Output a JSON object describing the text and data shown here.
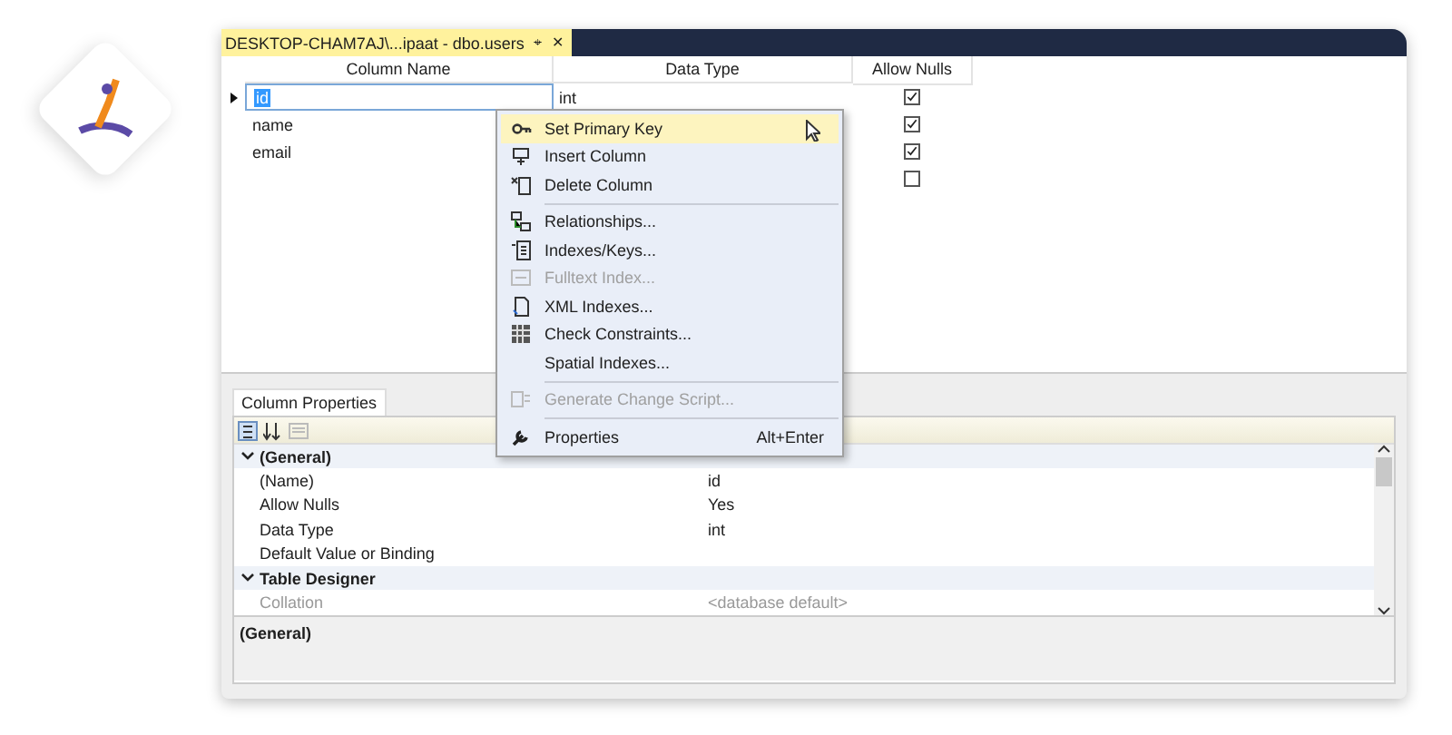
{
  "document_tab": {
    "title": "DESKTOP-CHAM7AJ\\...ipaat - dbo.users",
    "pin": "⌖",
    "close": "✕"
  },
  "table": {
    "columns": [
      "Column Name",
      "Data Type",
      "Allow Nulls"
    ],
    "rows": [
      {
        "current": true,
        "name": "id",
        "data_type": "int",
        "allow_nulls": true
      },
      {
        "current": false,
        "name": "name",
        "allow_nulls": true
      },
      {
        "current": false,
        "name": "email",
        "allow_nulls": true
      },
      {
        "current": false,
        "allow_nulls": false
      }
    ]
  },
  "context_menu": {
    "items": [
      {
        "kind": "item",
        "label": "Set Primary Key",
        "selected": true,
        "disabled": false
      },
      {
        "kind": "item",
        "label": "Insert Column",
        "selected": false,
        "disabled": false
      },
      {
        "kind": "item",
        "label": "Delete Column",
        "selected": false,
        "disabled": false
      },
      {
        "kind": "separator"
      },
      {
        "kind": "item",
        "label": "Relationships...",
        "selected": false,
        "disabled": false
      },
      {
        "kind": "item",
        "label": "Indexes/Keys...",
        "selected": false,
        "disabled": false
      },
      {
        "kind": "item",
        "label": "Fulltext Index...",
        "selected": false,
        "disabled": true
      },
      {
        "kind": "item",
        "label": "XML Indexes...",
        "selected": false,
        "disabled": false
      },
      {
        "kind": "item",
        "label": "Check Constraints...",
        "selected": false,
        "disabled": false
      },
      {
        "kind": "item",
        "label": "Spatial Indexes...",
        "selected": false,
        "disabled": false
      },
      {
        "kind": "separator"
      },
      {
        "kind": "item",
        "label": "Generate Change Script...",
        "selected": false,
        "disabled": true
      },
      {
        "kind": "separator"
      },
      {
        "kind": "item",
        "label": "Properties",
        "shortcut": "Alt+Enter",
        "selected": false,
        "disabled": false
      }
    ]
  },
  "column_properties": {
    "tab": "Column Properties",
    "categories": [
      {
        "name": "(General)",
        "expanded": true,
        "properties": [
          {
            "name": "(Name)",
            "value": "id",
            "disabled": false
          },
          {
            "name": "Allow Nulls",
            "value": "Yes",
            "disabled": false
          },
          {
            "name": "Data Type",
            "value": "int",
            "disabled": false
          },
          {
            "name": "Default Value or Binding",
            "disabled": false
          }
        ]
      },
      {
        "name": "Table Designer",
        "expanded": true,
        "properties": [
          {
            "name": "Collation",
            "value": "<database default>",
            "disabled": true
          }
        ]
      }
    ],
    "description": "(General)"
  }
}
